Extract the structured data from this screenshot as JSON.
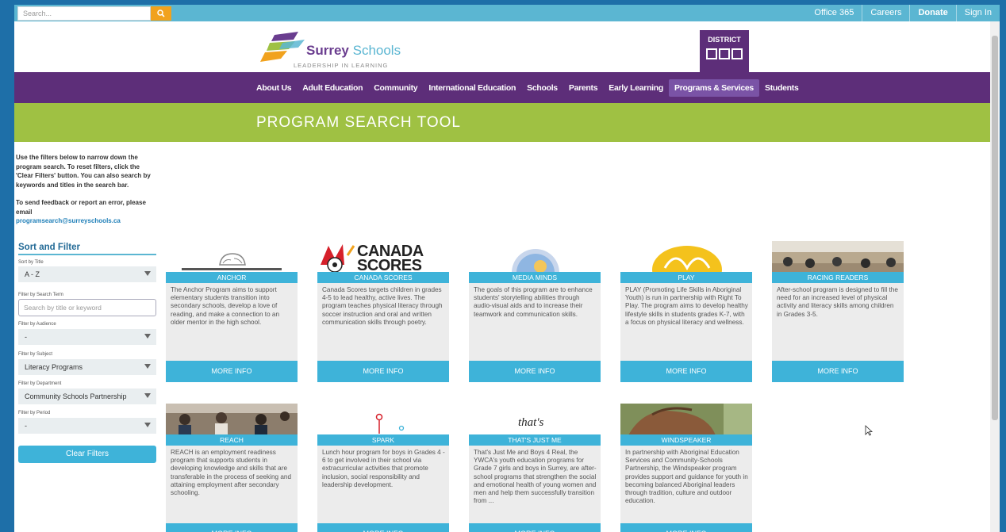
{
  "topbar": {
    "search_placeholder": "Search...",
    "links": [
      "Office 365",
      "Careers",
      "Donate",
      "Sign In"
    ]
  },
  "header": {
    "logo_name_bold": "Surrey",
    "logo_name_light": "Schools",
    "logo_tagline": "LEADERSHIP IN LEARNING",
    "district_label": "DISTRICT"
  },
  "nav": {
    "items": [
      "About Us",
      "Adult Education",
      "Community",
      "International Education",
      "Schools",
      "Parents",
      "Early Learning",
      "Programs & Services",
      "Students"
    ],
    "active": "Programs & Services"
  },
  "banner": {
    "title": "PROGRAM SEARCH TOOL"
  },
  "sidebar": {
    "intro": "Use the filters below to narrow down the program search. To reset filters, click the 'Clear Filters' button. You can also search by keywords and titles in the search bar.",
    "feedback": "To send feedback or report an error, please email",
    "email": "programsearch@surreyschools.ca",
    "sort_title": "Sort and Filter",
    "sort_label": "Sort by Title",
    "sort_value": "A - Z",
    "search_label": "Filter by Search Term",
    "search_placeholder": "Search by title or keyword",
    "audience_label": "Filter by Audience",
    "audience_value": "-",
    "subject_label": "Filter by Subject",
    "subject_value": "Literacy Programs",
    "department_label": "Filter by Department",
    "department_value": "Community Schools Partnership",
    "period_label": "Filter by Period",
    "period_value": "-",
    "clear_label": "Clear Filters"
  },
  "cards": [
    {
      "title": "ANCHOR",
      "desc": "The Anchor Program aims to support elementary students transition into secondary schools, develop a love of reading, and make a connection to an older mentor in the high school.",
      "more": "MORE INFO"
    },
    {
      "title": "CANADA SCORES",
      "desc": "Canada Scores targets children in grades 4-5 to lead healthy, active lives. The program teaches physical literacy through soccer instruction and oral and written communication skills through poetry.",
      "more": "MORE INFO",
      "logo_text": "CANADA SCORES"
    },
    {
      "title": "MEDIA MINDS",
      "desc": "The goals of this program are to enhance students' storytelling abilities through audio-visual aids and to increase their teamwork and communication skills.",
      "more": "MORE INFO"
    },
    {
      "title": "PLAY",
      "desc": "PLAY (Promoting Life Skills in Aboriginal Youth) is run in partnership with Right To Play. The program aims to develop healthy lifestyle skills in students grades K-7, with a focus on physical literacy and wellness.",
      "more": "MORE INFO"
    },
    {
      "title": "RACING READERS",
      "desc": "After-school program is designed to fill the need for an increased level of physical activity and literacy skills among children in Grades 3-5.",
      "more": "MORE INFO"
    },
    {
      "title": "REACH",
      "desc": "REACH is an employment readiness program that supports students in developing knowledge and skills that are transferable in the process of seeking and attaining employment after secondary schooling.",
      "more": "MORE INFO"
    },
    {
      "title": "SPARK",
      "desc": "Lunch hour program for boys in Grades 4 - 6 to get involved in their school via extracurricular activities that promote inclusion, social responsibility and leadership development.",
      "more": "MORE INFO"
    },
    {
      "title": "THAT'S JUST ME",
      "desc": "That's Just Me and Boys 4 Real, the YWCA's youth education programs for Grade 7 girls and boys in Surrey, are after-school programs that strengthen the social and emotional health of young women and men and help them successfully transition from ...",
      "more": "MORE INFO",
      "logo_text": "that's"
    },
    {
      "title": "WINDSPEAKER",
      "desc": "In partnership with Aboriginal Education Services and Community-Schools Partnership, the Windspeaker program provides support and guidance for youth in becoming balanced Aboriginal leaders through tradition, culture and outdoor education.",
      "more": "MORE INFO"
    }
  ]
}
